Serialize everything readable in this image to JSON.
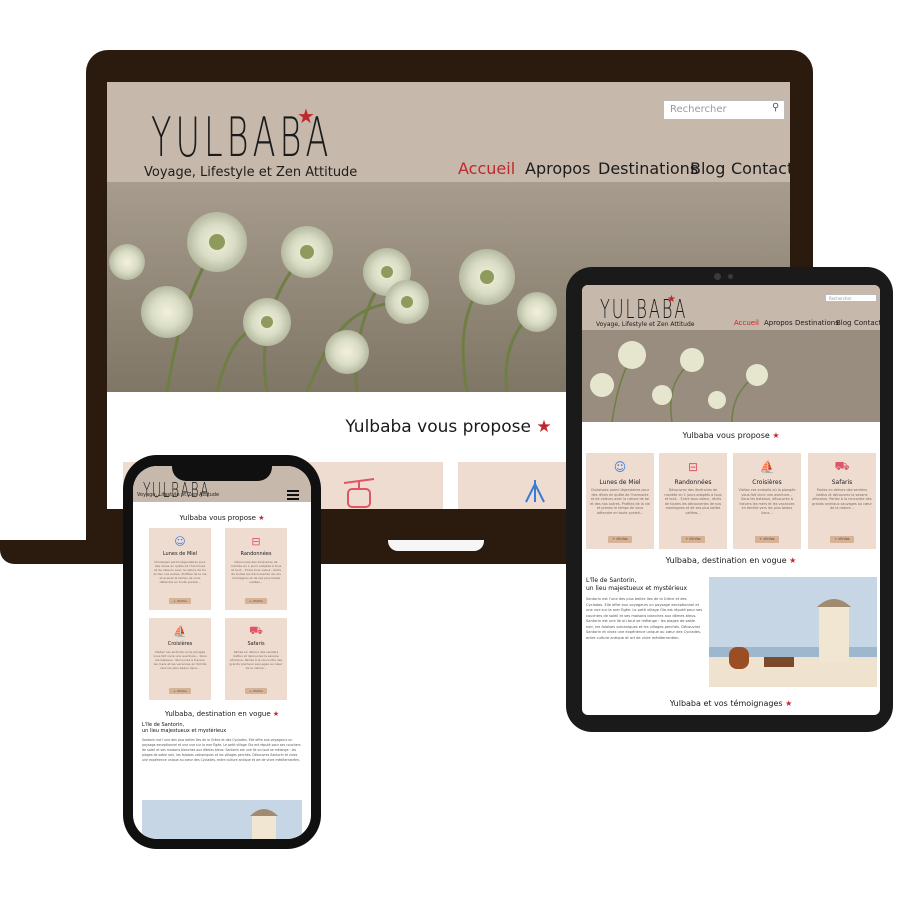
{
  "brand": {
    "name": "YULBABA",
    "tagline": "Voyage, Lifestyle et Zen Attitude",
    "accent_color": "#c1272d",
    "header_bg": "#c6b8aa",
    "card_bg": "#efdcd1"
  },
  "search": {
    "placeholder": "Rechercher",
    "icon": "search-icon"
  },
  "nav": [
    {
      "label": "Accueil",
      "active": true
    },
    {
      "label": "Apropos"
    },
    {
      "label": "Destinations"
    },
    {
      "label": "Blog"
    },
    {
      "label": "Contact"
    }
  ],
  "sections": {
    "propose": "Yulbaba vous propose",
    "destination": "Yulbaba, destination en vogue",
    "temoignages": "Yulbaba et vos témoignages"
  },
  "cards": [
    {
      "title": "Lunes de Miel",
      "icon": "lovers-icon",
      "text": "Choisissez parmi légendaires pour des rêves en quête de l'harmonie et de valeurs avec la nature de toi et des nos autres. Profitez de la vie et prenez le temps de vous détendre en toute pureté...",
      "button": "+ d'infos"
    },
    {
      "title": "Randonnées",
      "icon": "cable-car-icon",
      "text": "Découvrez des itinéraires de montée en 1 jours adaptés à tous et tout... Entre tous valeur, récits de toutes les découvertes de nos montagnes et de ses plus belles vallées...",
      "button": "+ d'infos"
    },
    {
      "title": "Croisières",
      "icon": "sailboat-icon",
      "text": "Visitez ces endroits où la plongée vous fait vivre une aventure... Sous les bateaux, découvrez à travers les mers et les vacances en famille vers les plus beaux lieux...",
      "button": "+ d'infos"
    },
    {
      "title": "Safaris",
      "icon": "jeep-icon",
      "text": "Partez en dehors des sentiers battus et découvrez la savane africaine. Partez à la rencontre des grands animaux sauvages au cœur de la nature...",
      "button": "+ d'infos"
    }
  ],
  "destination": {
    "heading_line1": "L'île de Santorin,",
    "heading_line2": "un lieu majestueux et mystérieux",
    "body": "Santorin est l'une des plus belles îles de la Grèce et des Cyclades. Elle offre aux voyageurs un paysage exceptionnel et une vue sur la mer Égée. Le petit village Oia est réputé pour ses couchers de soleil et ses maisons blanches aux dômes bleus. Santorin est une île où tout se mélange : les plages de sable noir, les falaises volcaniques et les villages perchés. Découvrez Santorin et vivez une expérience unique au cœur des Cyclades, entre culture antique et art de vivre méditerranéen."
  }
}
